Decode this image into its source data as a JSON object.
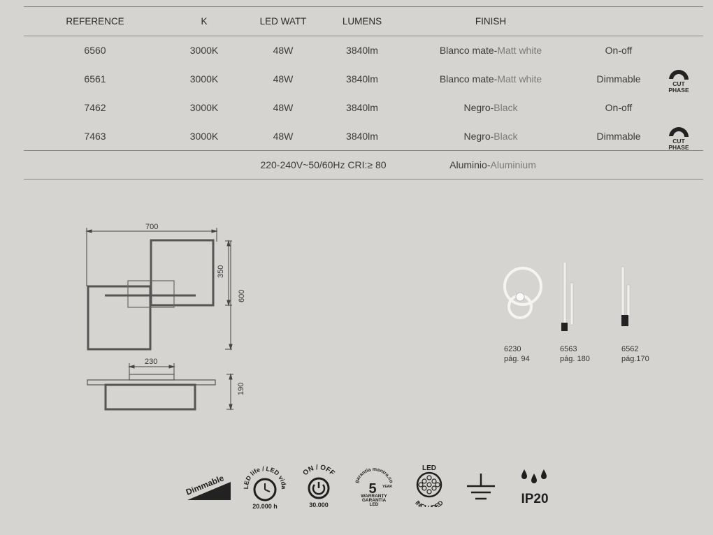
{
  "table": {
    "headers": {
      "reference": "REFERENCE",
      "k": "K",
      "led_watt": "LED WATT",
      "lumens": "LUMENS",
      "finish": "FINISH"
    },
    "rows": [
      {
        "reference": "6560",
        "k": "3000K",
        "watt": "48W",
        "lumens": "3840lm",
        "finish_es": "Blanco mate-",
        "finish_en": "Matt white",
        "control": "On-off",
        "cut_phase": false
      },
      {
        "reference": "6561",
        "k": "3000K",
        "watt": "48W",
        "lumens": "3840lm",
        "finish_es": "Blanco mate-",
        "finish_en": "Matt white",
        "control": "Dimmable",
        "cut_phase": true
      },
      {
        "reference": "7462",
        "k": "3000K",
        "watt": "48W",
        "lumens": "3840lm",
        "finish_es": "Negro-",
        "finish_en": "Black",
        "control": "On-off",
        "cut_phase": false
      },
      {
        "reference": "7463",
        "k": "3000K",
        "watt": "48W",
        "lumens": "3840lm",
        "finish_es": "Negro-",
        "finish_en": "Black",
        "control": "Dimmable",
        "cut_phase": true
      }
    ],
    "cut_phase_line1": "CUT",
    "cut_phase_line2": "PHASE",
    "footer": {
      "electrical": "220-240V~50/60Hz CRI:≥ 80",
      "material_es": "Aluminio-",
      "material_en": "Aluminium"
    }
  },
  "drawing": {
    "width": "700",
    "height": "600",
    "half_height": "350",
    "base_width": "230",
    "depth": "190"
  },
  "related": [
    {
      "ref": "6230",
      "page": "pág. 94"
    },
    {
      "ref": "6563",
      "page": "pág. 180"
    },
    {
      "ref": "6562",
      "page": "pág.170"
    }
  ],
  "icons": {
    "dimmable": "Dimmable",
    "led_life": "LED life / LED vida",
    "led_life_hours": "20.000 h",
    "onoff": "ON / OFF",
    "onoff_cycles": "30.000",
    "warranty_top": "garantía mantra.co",
    "warranty_number": "5",
    "warranty_year": "YEAR",
    "warranty_line1": "WARRANTY",
    "warranty_line2": "GARANTÍA",
    "warranty_line3": "LED",
    "led_included_top": "LED",
    "led_included_bottom": "INCLUDED",
    "ip_rating": "IP20"
  }
}
